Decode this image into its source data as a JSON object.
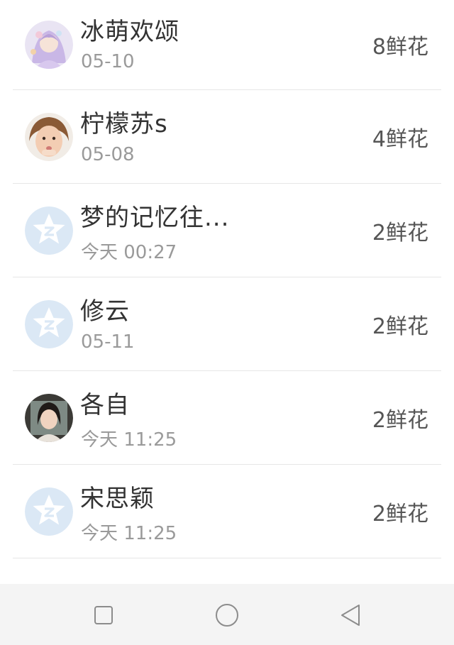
{
  "contacts": [
    {
      "name": "冰萌欢颂",
      "time": "05-10",
      "flowers": "8鲜花",
      "avatar": "anime-girl-avatar"
    },
    {
      "name": "柠檬苏s",
      "time": "05-08",
      "flowers": "4鲜花",
      "avatar": "child-photo-avatar"
    },
    {
      "name": "梦的记忆往...",
      "time": "今天 00:27",
      "flowers": "2鲜花",
      "avatar": "default-qzone-star-avatar"
    },
    {
      "name": "修云",
      "time": "05-11",
      "flowers": "2鲜花",
      "avatar": "default-qzone-star-avatar"
    },
    {
      "name": "各自",
      "time": "今天 11:25",
      "flowers": "2鲜花",
      "avatar": "woman-photo-avatar"
    },
    {
      "name": "宋思颖",
      "time": "今天 11:25",
      "flowers": "2鲜花",
      "avatar": "default-qzone-star-avatar"
    }
  ],
  "navbar": {
    "recent_icon": "square-icon",
    "home_icon": "circle-icon",
    "back_icon": "triangle-back-icon"
  },
  "colors": {
    "name_text": "#333333",
    "time_text": "#9a9a9a",
    "divider": "#e6e6e6",
    "default_avatar_bg": "#dbe8f5",
    "navbar_bg": "#f4f4f4"
  }
}
